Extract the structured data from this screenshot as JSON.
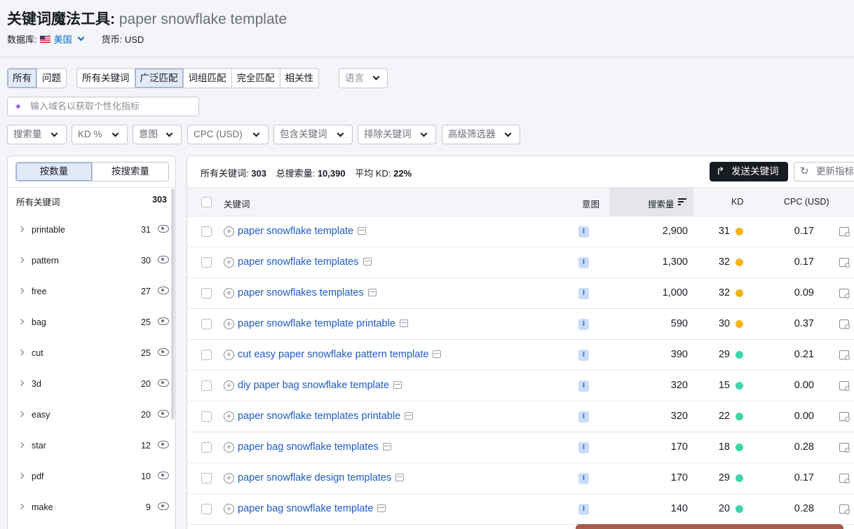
{
  "header": {
    "title": "关键词魔法工具:",
    "query": "paper snowflake template",
    "database_label": "数据库:",
    "country": "美国",
    "currency": "货币: USD"
  },
  "match_tabs": [
    "所有",
    "问题"
  ],
  "type_tabs": [
    "所有关键词",
    "广泛匹配",
    "词组匹配",
    "完全匹配",
    "相关性"
  ],
  "language_label": "语言",
  "domain_placeholder": "输入域名以获取个性化指标",
  "filters": [
    "搜索量",
    "KD %",
    "意图",
    "CPC (USD)",
    "包含关键词",
    "排除关键词",
    "高级筛选器"
  ],
  "sidebar": {
    "toggle": [
      "按数量",
      "按搜索量"
    ],
    "all_label": "所有关键词",
    "all_count": "303",
    "groups": [
      {
        "label": "printable",
        "count": "31"
      },
      {
        "label": "pattern",
        "count": "30"
      },
      {
        "label": "free",
        "count": "27"
      },
      {
        "label": "bag",
        "count": "25"
      },
      {
        "label": "cut",
        "count": "25"
      },
      {
        "label": "3d",
        "count": "20"
      },
      {
        "label": "easy",
        "count": "20"
      },
      {
        "label": "star",
        "count": "12"
      },
      {
        "label": "pdf",
        "count": "10"
      },
      {
        "label": "make",
        "count": "9"
      }
    ]
  },
  "summary": {
    "all_label": "所有关键词:",
    "all_value": "303",
    "volume_label": "总搜索量:",
    "volume_value": "10,390",
    "kd_label": "平均 KD:",
    "kd_value": "22%"
  },
  "actions": {
    "send": "发送关键词",
    "update": "更新指标"
  },
  "table": {
    "headers": {
      "keyword": "关键词",
      "intent": "意图",
      "volume": "搜索量",
      "kd": "KD",
      "cpc": "CPC (USD)"
    },
    "colors": {
      "kd_medium": "#f5b21b",
      "kd_easy": "#3fd5a8"
    },
    "rows": [
      {
        "keyword": "paper snowflake template",
        "intent": "I",
        "volume": "2,900",
        "kd": "31",
        "level": "medium",
        "cpc": "0.17"
      },
      {
        "keyword": "paper snowflake templates",
        "intent": "I",
        "volume": "1,300",
        "kd": "32",
        "level": "medium",
        "cpc": "0.17"
      },
      {
        "keyword": "paper snowflakes templates",
        "intent": "I",
        "volume": "1,000",
        "kd": "32",
        "level": "medium",
        "cpc": "0.09"
      },
      {
        "keyword": "paper snowflake template printable",
        "intent": "I",
        "volume": "590",
        "kd": "30",
        "level": "medium",
        "cpc": "0.37"
      },
      {
        "keyword": "cut easy paper snowflake pattern template",
        "intent": "I",
        "volume": "390",
        "kd": "29",
        "level": "easy",
        "cpc": "0.21"
      },
      {
        "keyword": "diy paper bag snowflake template",
        "intent": "I",
        "volume": "320",
        "kd": "15",
        "level": "easy",
        "cpc": "0.00"
      },
      {
        "keyword": "paper snowflake templates printable",
        "intent": "I",
        "volume": "320",
        "kd": "22",
        "level": "easy",
        "cpc": "0.00"
      },
      {
        "keyword": "paper bag snowflake templates",
        "intent": "I",
        "volume": "170",
        "kd": "18",
        "level": "easy",
        "cpc": "0.28"
      },
      {
        "keyword": "paper snowflake design templates",
        "intent": "I",
        "volume": "170",
        "kd": "29",
        "level": "easy",
        "cpc": "0.17"
      },
      {
        "keyword": "paper bag snowflake template",
        "intent": "I",
        "volume": "140",
        "kd": "20",
        "level": "easy",
        "cpc": "0.28"
      }
    ]
  }
}
